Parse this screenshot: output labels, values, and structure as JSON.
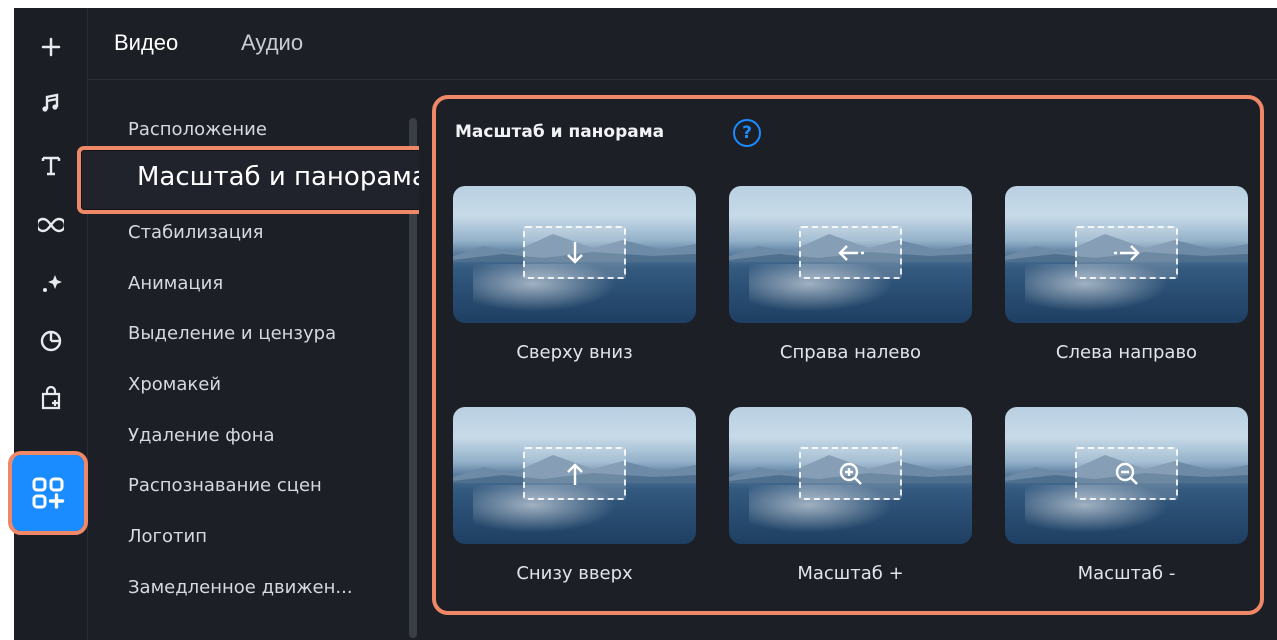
{
  "toolbar": {
    "icons": [
      "plus-icon",
      "music-icon",
      "text-icon",
      "transitions-icon",
      "effects-icon",
      "sticker-icon",
      "callouts-icon",
      "more-tools-icon"
    ]
  },
  "tabs": {
    "video": "Видео",
    "audio": "Аудио"
  },
  "categories": [
    "Расположение",
    "Масштаб и панорама",
    "Стабилизация",
    "Анимация",
    "Выделение и цензура",
    "Хромакей",
    "Удаление фона",
    "Распознавание сцен",
    "Логотип",
    "Замедленное движен..."
  ],
  "highlighted_category": "Масштаб и панорама",
  "panel": {
    "title": "Масштаб и панорама",
    "help": "?",
    "items": [
      {
        "label": "Сверху вниз",
        "icon": "arrow-down-icon"
      },
      {
        "label": "Справа налево",
        "icon": "arrow-left-icon"
      },
      {
        "label": "Слева направо",
        "icon": "arrow-right-icon"
      },
      {
        "label": "Снизу вверх",
        "icon": "arrow-up-icon"
      },
      {
        "label": "Масштаб +",
        "icon": "zoom-in-icon"
      },
      {
        "label": "Масштаб -",
        "icon": "zoom-out-icon"
      }
    ]
  },
  "colors": {
    "accent": "#1a8cff",
    "highlight_border": "#ee8867",
    "background": "#1c1f26"
  }
}
